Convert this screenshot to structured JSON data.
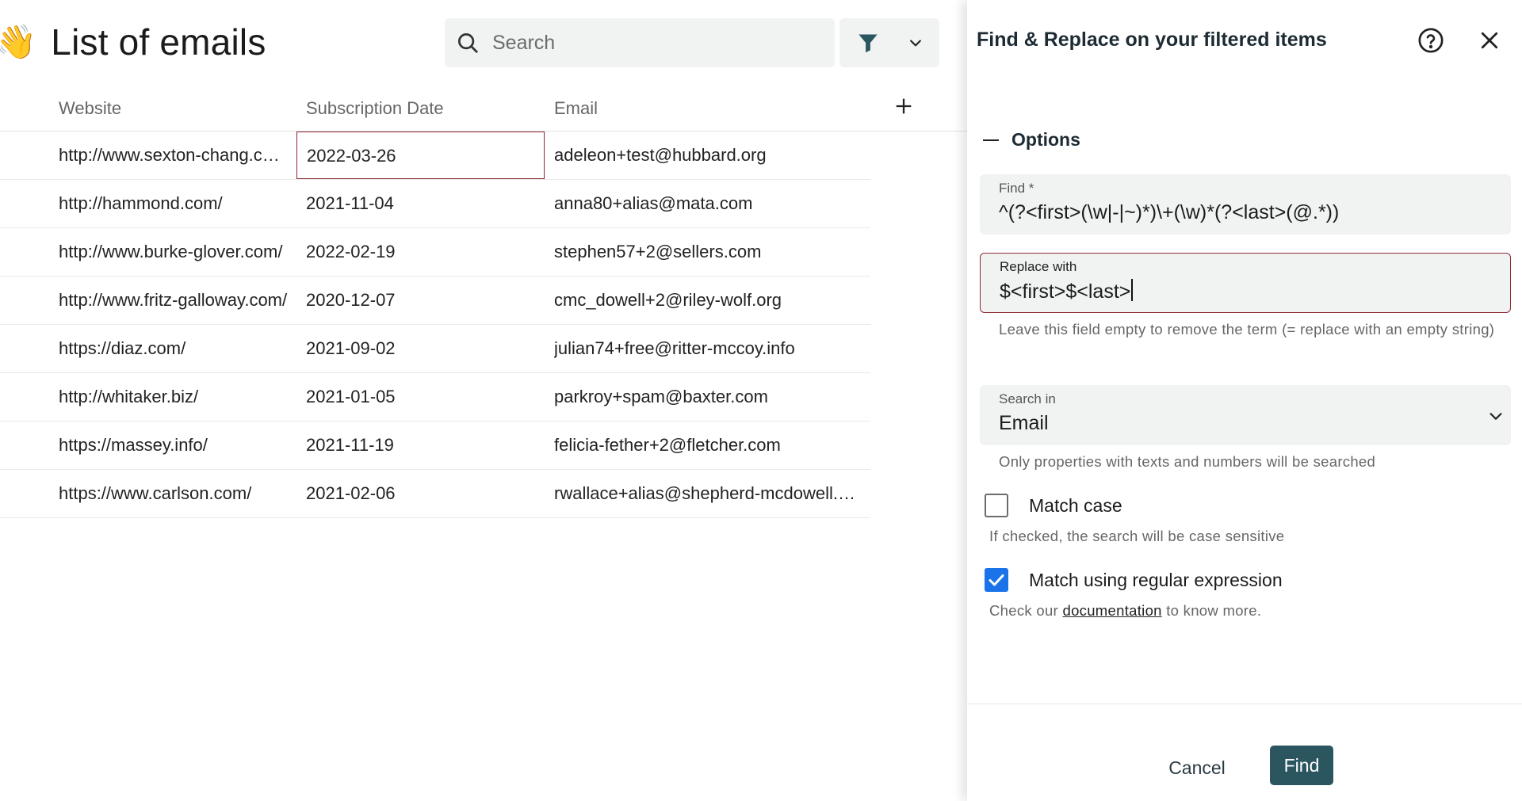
{
  "header": {
    "emoji": "👋",
    "title": "List of emails",
    "search_placeholder": "Search"
  },
  "icons": {
    "search": "search-icon",
    "filter": "filter-icon",
    "dropdown": "chevron-down-icon",
    "add_column": "plus-icon",
    "help": "help-circle-icon",
    "close": "close-icon",
    "checkbox_checked": "check-icon"
  },
  "table": {
    "columns": [
      "Website",
      "Subscription Date",
      "Email"
    ],
    "rows": [
      [
        "http://www.sexton-chang.com/",
        "2022-03-26",
        "adeleon+test@hubbard.org"
      ],
      [
        "http://hammond.com/",
        "2021-11-04",
        "anna80+alias@mata.com"
      ],
      [
        "http://www.burke-glover.com/",
        "2022-02-19",
        "stephen57+2@sellers.com"
      ],
      [
        "http://www.fritz-galloway.com/",
        "2020-12-07",
        "cmc_dowell+2@riley-wolf.org"
      ],
      [
        "https://diaz.com/",
        "2021-09-02",
        "julian74+free@ritter-mccoy.info"
      ],
      [
        "http://whitaker.biz/",
        "2021-01-05",
        "parkroy+spam@baxter.com"
      ],
      [
        "https://massey.info/",
        "2021-11-19",
        "felicia-fether+2@fletcher.com"
      ],
      [
        "https://www.carlson.com/",
        "2021-02-06",
        "rwallace+alias@shepherd-mcdowell.com"
      ]
    ]
  },
  "drawer": {
    "title": "Find & Replace on your filtered items",
    "options_label": "Options",
    "find": {
      "label": "Find *",
      "value": "^(?<first>(\\w|-|~)*)\\+(\\w)*(?<last>(@.*))"
    },
    "replace": {
      "label": "Replace with",
      "value": "$<first>$<last>",
      "helper": "Leave this field empty to remove the term (= replace with an empty string)"
    },
    "search_in": {
      "label": "Search in",
      "value": "Email",
      "helper": "Only properties with texts and numbers will be searched"
    },
    "match_case": {
      "label": "Match case",
      "checked": false,
      "helper": "If checked, the search will be case sensitive"
    },
    "regex": {
      "label": "Match using regular expression",
      "checked": true,
      "helper_prefix": "Check our",
      "helper_link": "documentation",
      "helper_suffix": "to know more."
    },
    "cancel_label": "Cancel",
    "find_label": "Find"
  },
  "colors": {
    "accent_dark": "#2b5660",
    "selection_border": "#8a2a33",
    "checkbox_blue": "#1a73e8",
    "field_bg": "#f1f3f3"
  }
}
